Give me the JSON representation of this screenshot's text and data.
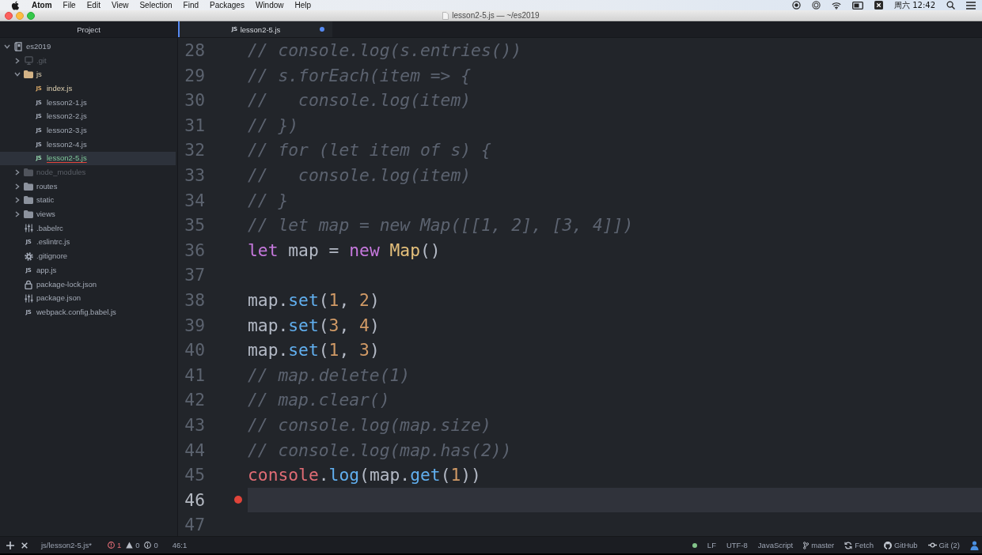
{
  "menu_bar": {
    "items": [
      {
        "label": "Atom",
        "kind": "app"
      },
      {
        "label": "File",
        "kind": "menu"
      },
      {
        "label": "Edit",
        "kind": "menu"
      },
      {
        "label": "View",
        "kind": "menu"
      },
      {
        "label": "Selection",
        "kind": "menu"
      },
      {
        "label": "Find",
        "kind": "menu"
      },
      {
        "label": "Packages",
        "kind": "menu"
      },
      {
        "label": "Window",
        "kind": "menu"
      },
      {
        "label": "Help",
        "kind": "menu"
      }
    ],
    "clock": "周六 12:42"
  },
  "window": {
    "title": "lesson2-5.js — ~/es2019"
  },
  "sidebar": {
    "title": "Project",
    "tree": [
      {
        "label": "es2019",
        "kind": "repo",
        "expanded": true,
        "modified": false,
        "added": false,
        "ignored": false,
        "selected": false,
        "error": false,
        "children": [
          {
            "label": ".git",
            "kind": "git_folder",
            "expanded": false,
            "modified": false,
            "added": false,
            "ignored": true,
            "selected": false,
            "error": false
          },
          {
            "label": "js",
            "kind": "folder",
            "expanded": true,
            "modified": true,
            "added": false,
            "ignored": false,
            "selected": false,
            "error": false,
            "children": [
              {
                "label": "index.js",
                "kind": "js",
                "icon_label": "JS",
                "modified": true,
                "added": false,
                "ignored": false,
                "selected": false,
                "error": false
              },
              {
                "label": "lesson2-1.js",
                "kind": "js",
                "icon_label": "JS",
                "modified": false,
                "added": false,
                "ignored": false,
                "selected": false,
                "error": false
              },
              {
                "label": "lesson2-2.js",
                "kind": "js",
                "icon_label": "JS",
                "modified": false,
                "added": false,
                "ignored": false,
                "selected": false,
                "error": false
              },
              {
                "label": "lesson2-3.js",
                "kind": "js",
                "icon_label": "JS",
                "modified": false,
                "added": false,
                "ignored": false,
                "selected": false,
                "error": false
              },
              {
                "label": "lesson2-4.js",
                "kind": "js",
                "icon_label": "JS",
                "modified": false,
                "added": false,
                "ignored": false,
                "selected": false,
                "error": false
              },
              {
                "label": "lesson2-5.js",
                "kind": "js",
                "icon_label": "JS",
                "modified": false,
                "added": true,
                "ignored": false,
                "selected": true,
                "error": true
              }
            ]
          },
          {
            "label": "node_modules",
            "kind": "folder",
            "expanded": false,
            "modified": false,
            "added": false,
            "ignored": true,
            "selected": false,
            "error": false
          },
          {
            "label": "routes",
            "kind": "folder",
            "expanded": false,
            "modified": false,
            "added": false,
            "ignored": false,
            "selected": false,
            "error": false
          },
          {
            "label": "static",
            "kind": "folder",
            "expanded": false,
            "modified": false,
            "added": false,
            "ignored": false,
            "selected": false,
            "error": false
          },
          {
            "label": "views",
            "kind": "folder",
            "expanded": false,
            "modified": false,
            "added": false,
            "ignored": false,
            "selected": false,
            "error": false
          },
          {
            "label": ".babelrc",
            "kind": "config",
            "modified": false,
            "added": false,
            "ignored": false,
            "selected": false,
            "error": false
          },
          {
            "label": ".eslintrc.js",
            "kind": "js",
            "icon_label": "JS",
            "modified": false,
            "added": false,
            "ignored": false,
            "selected": false,
            "error": false
          },
          {
            "label": ".gitignore",
            "kind": "gear",
            "modified": false,
            "added": false,
            "ignored": false,
            "selected": false,
            "error": false
          },
          {
            "label": "app.js",
            "kind": "js",
            "icon_label": "JS",
            "modified": false,
            "added": false,
            "ignored": false,
            "selected": false,
            "error": false
          },
          {
            "label": "package-lock.json",
            "kind": "lock",
            "modified": false,
            "added": false,
            "ignored": false,
            "selected": false,
            "error": false
          },
          {
            "label": "package.json",
            "kind": "config",
            "modified": false,
            "added": false,
            "ignored": false,
            "selected": false,
            "error": false
          },
          {
            "label": "webpack.config.babel.js",
            "kind": "js",
            "icon_label": "JS",
            "modified": false,
            "added": false,
            "ignored": false,
            "selected": false,
            "error": false
          }
        ]
      }
    ]
  },
  "tabs": [
    {
      "label": "lesson2-5.js",
      "icon_label": "JS",
      "selected": true,
      "modified": true
    }
  ],
  "editor": {
    "lines": [
      {
        "number": "28",
        "selected": false,
        "lint_error": false,
        "tokens": [
          {
            "text": "// console.log(s.entries())",
            "kind": "comment"
          }
        ]
      },
      {
        "number": "29",
        "selected": false,
        "lint_error": false,
        "tokens": [
          {
            "text": "// s.forEach(item => {",
            "kind": "comment"
          }
        ]
      },
      {
        "number": "30",
        "selected": false,
        "lint_error": false,
        "tokens": [
          {
            "text": "//   console.log(item)",
            "kind": "comment"
          }
        ]
      },
      {
        "number": "31",
        "selected": false,
        "lint_error": false,
        "tokens": [
          {
            "text": "// })",
            "kind": "comment"
          }
        ]
      },
      {
        "number": "32",
        "selected": false,
        "lint_error": false,
        "tokens": [
          {
            "text": "// for (let item of s) {",
            "kind": "comment"
          }
        ]
      },
      {
        "number": "33",
        "selected": false,
        "lint_error": false,
        "tokens": [
          {
            "text": "//   console.log(item)",
            "kind": "comment"
          }
        ]
      },
      {
        "number": "34",
        "selected": false,
        "lint_error": false,
        "tokens": [
          {
            "text": "// }",
            "kind": "comment"
          }
        ]
      },
      {
        "number": "35",
        "selected": false,
        "lint_error": false,
        "tokens": [
          {
            "text": "// let map = new Map([[1, 2], [3, 4]])",
            "kind": "comment"
          }
        ]
      },
      {
        "number": "36",
        "selected": false,
        "lint_error": false,
        "tokens": [
          {
            "text": "let",
            "kind": "keyword"
          },
          {
            "text": " map = ",
            "kind": "plain"
          },
          {
            "text": "new",
            "kind": "keyword"
          },
          {
            "text": " Map",
            "kind": "class"
          },
          {
            "text": "()",
            "kind": "plain"
          }
        ]
      },
      {
        "number": "37",
        "selected": false,
        "lint_error": false
      },
      {
        "number": "38",
        "selected": false,
        "lint_error": false,
        "tokens": [
          {
            "text": "map.",
            "kind": "plain"
          },
          {
            "text": "set",
            "kind": "function"
          },
          {
            "text": "(",
            "kind": "plain"
          },
          {
            "text": "1",
            "kind": "number"
          },
          {
            "text": ", ",
            "kind": "plain"
          },
          {
            "text": "2",
            "kind": "number"
          },
          {
            "text": ")",
            "kind": "plain"
          }
        ]
      },
      {
        "number": "39",
        "selected": false,
        "lint_error": false,
        "tokens": [
          {
            "text": "map.",
            "kind": "plain"
          },
          {
            "text": "set",
            "kind": "function"
          },
          {
            "text": "(",
            "kind": "plain"
          },
          {
            "text": "3",
            "kind": "number"
          },
          {
            "text": ", ",
            "kind": "plain"
          },
          {
            "text": "4",
            "kind": "number"
          },
          {
            "text": ")",
            "kind": "plain"
          }
        ]
      },
      {
        "number": "40",
        "selected": false,
        "lint_error": false,
        "tokens": [
          {
            "text": "map.",
            "kind": "plain"
          },
          {
            "text": "set",
            "kind": "function"
          },
          {
            "text": "(",
            "kind": "plain"
          },
          {
            "text": "1",
            "kind": "number"
          },
          {
            "text": ", ",
            "kind": "plain"
          },
          {
            "text": "3",
            "kind": "number"
          },
          {
            "text": ")",
            "kind": "plain"
          }
        ]
      },
      {
        "number": "41",
        "selected": false,
        "lint_error": false,
        "tokens": [
          {
            "text": "// map.delete(1)",
            "kind": "comment"
          }
        ]
      },
      {
        "number": "42",
        "selected": false,
        "lint_error": false,
        "tokens": [
          {
            "text": "// map.clear()",
            "kind": "comment"
          }
        ]
      },
      {
        "number": "43",
        "selected": false,
        "lint_error": false,
        "tokens": [
          {
            "text": "// console.log(map.size)",
            "kind": "comment"
          }
        ]
      },
      {
        "number": "44",
        "selected": false,
        "lint_error": false,
        "tokens": [
          {
            "text": "// console.log(map.has(2))",
            "kind": "comment"
          }
        ]
      },
      {
        "number": "45",
        "selected": false,
        "lint_error": false,
        "tokens": [
          {
            "text": "console",
            "kind": "object"
          },
          {
            "text": ".",
            "kind": "plain"
          },
          {
            "text": "log",
            "kind": "function"
          },
          {
            "text": "(map.",
            "kind": "plain"
          },
          {
            "text": "get",
            "kind": "function"
          },
          {
            "text": "(",
            "kind": "plain"
          },
          {
            "text": "1",
            "kind": "number"
          },
          {
            "text": "))",
            "kind": "plain"
          }
        ]
      },
      {
        "number": "46",
        "selected": true,
        "lint_error": true
      },
      {
        "number": "47",
        "selected": false,
        "lint_error": false
      }
    ]
  },
  "status_bar": {
    "file_path": "js/lesson2-5.js*",
    "lint": [
      {
        "kind": "error",
        "count": "1"
      },
      {
        "kind": "warning",
        "count": "0"
      },
      {
        "kind": "info",
        "count": "0"
      }
    ],
    "cursor": "46:1",
    "items": [
      {
        "kind": "plain",
        "label": "LF"
      },
      {
        "kind": "plain",
        "label": "UTF-8"
      },
      {
        "kind": "plain",
        "label": "JavaScript"
      },
      {
        "kind": "branch",
        "label": "master"
      },
      {
        "kind": "fetch",
        "label": "Fetch"
      },
      {
        "kind": "github",
        "label": "GitHub"
      },
      {
        "kind": "git",
        "label": "Git (2)"
      }
    ]
  }
}
